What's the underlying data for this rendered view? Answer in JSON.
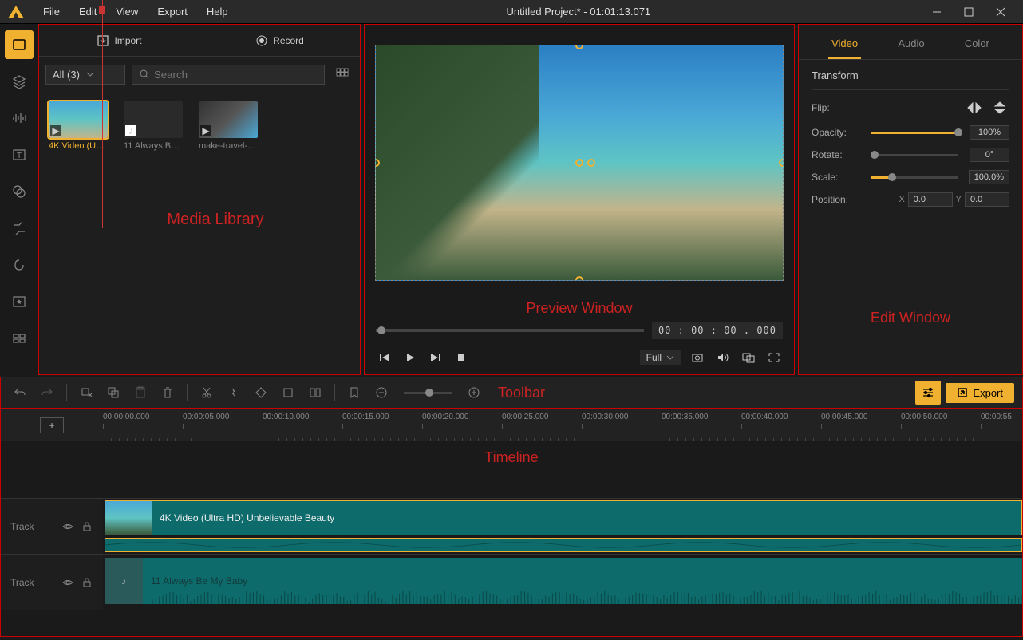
{
  "title": "Untitled Project* - 01:01:13.071",
  "menu": [
    "File",
    "Edit",
    "View",
    "Export",
    "Help"
  ],
  "media": {
    "import": "Import",
    "record": "Record",
    "filter": "All (3)",
    "search_placeholder": "Search",
    "items": [
      {
        "label": "4K Video (U…",
        "selected": true
      },
      {
        "label": "11 Always B…",
        "selected": false
      },
      {
        "label": "make-travel-…",
        "selected": false
      }
    ],
    "overlay": "Media Library"
  },
  "preview": {
    "overlay": "Preview Window",
    "timecode": "00 : 00 : 00 . 000",
    "quality": "Full"
  },
  "edit": {
    "tabs": [
      "Video",
      "Audio",
      "Color"
    ],
    "section": "Transform",
    "flip": "Flip:",
    "opacity": {
      "label": "Opacity:",
      "value": "100%"
    },
    "rotate": {
      "label": "Rotate:",
      "value": "0°"
    },
    "scale": {
      "label": "Scale:",
      "value": "100.0%"
    },
    "position": {
      "label": "Position:",
      "x": "0.0",
      "y": "0.0"
    },
    "overlay": "Edit Window"
  },
  "toolbar": {
    "label": "Toolbar",
    "export": "Export"
  },
  "timeline": {
    "label": "Timeline",
    "ticks": [
      "00:00:00.000",
      "00:00:05.000",
      "00:00:10.000",
      "00:00:15.000",
      "00:00:20.000",
      "00:00:25.000",
      "00:00:30.000",
      "00:00:35.000",
      "00:00:40.000",
      "00:00:45.000",
      "00:00:50.000",
      "00:00:55"
    ],
    "track_label": "Track",
    "clip_video": "4K Video (Ultra HD) Unbelievable Beauty",
    "clip_audio": "11 Always Be My Baby"
  }
}
